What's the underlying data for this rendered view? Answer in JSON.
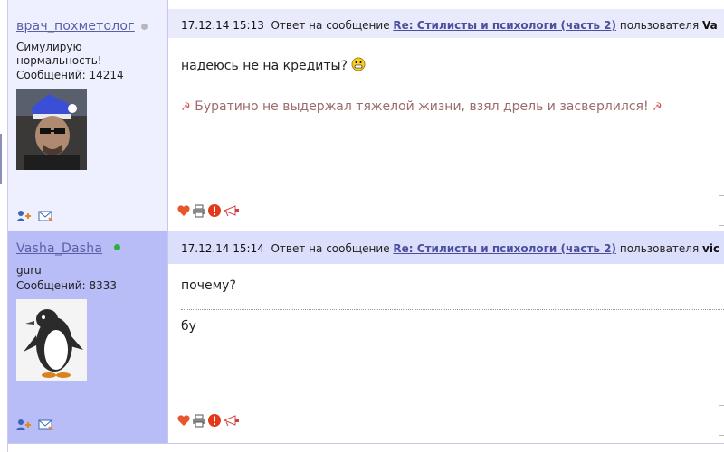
{
  "posts": [
    {
      "username": "врач_похметолог",
      "online": false,
      "status_lines": [
        "Симулирую",
        "нормальность!"
      ],
      "messages_count": "Сообщений: 14214",
      "header": {
        "date": "17.12.14 15:13",
        "reply_prefix": "Ответ на сообщение",
        "topic": "Re: Стилисты и психологи (часть 2)",
        "user_prefix": "пользователя",
        "user": "Va"
      },
      "message": "надеюсь не на кредиты?",
      "signature": "Буратино не выдержал тяжелой жизни, взял дрель и засверлился!"
    },
    {
      "username": "Vasha_Dasha",
      "online": true,
      "status_lines": [
        "guru"
      ],
      "messages_count": "Сообщений: 8333",
      "header": {
        "date": "17.12.14 15:14",
        "reply_prefix": "Ответ на сообщение",
        "topic": "Re: Стилисты и психологи (часть 2)",
        "user_prefix": "пользователя",
        "user": "vic"
      },
      "message": "почему?",
      "signature": "бу"
    }
  ]
}
